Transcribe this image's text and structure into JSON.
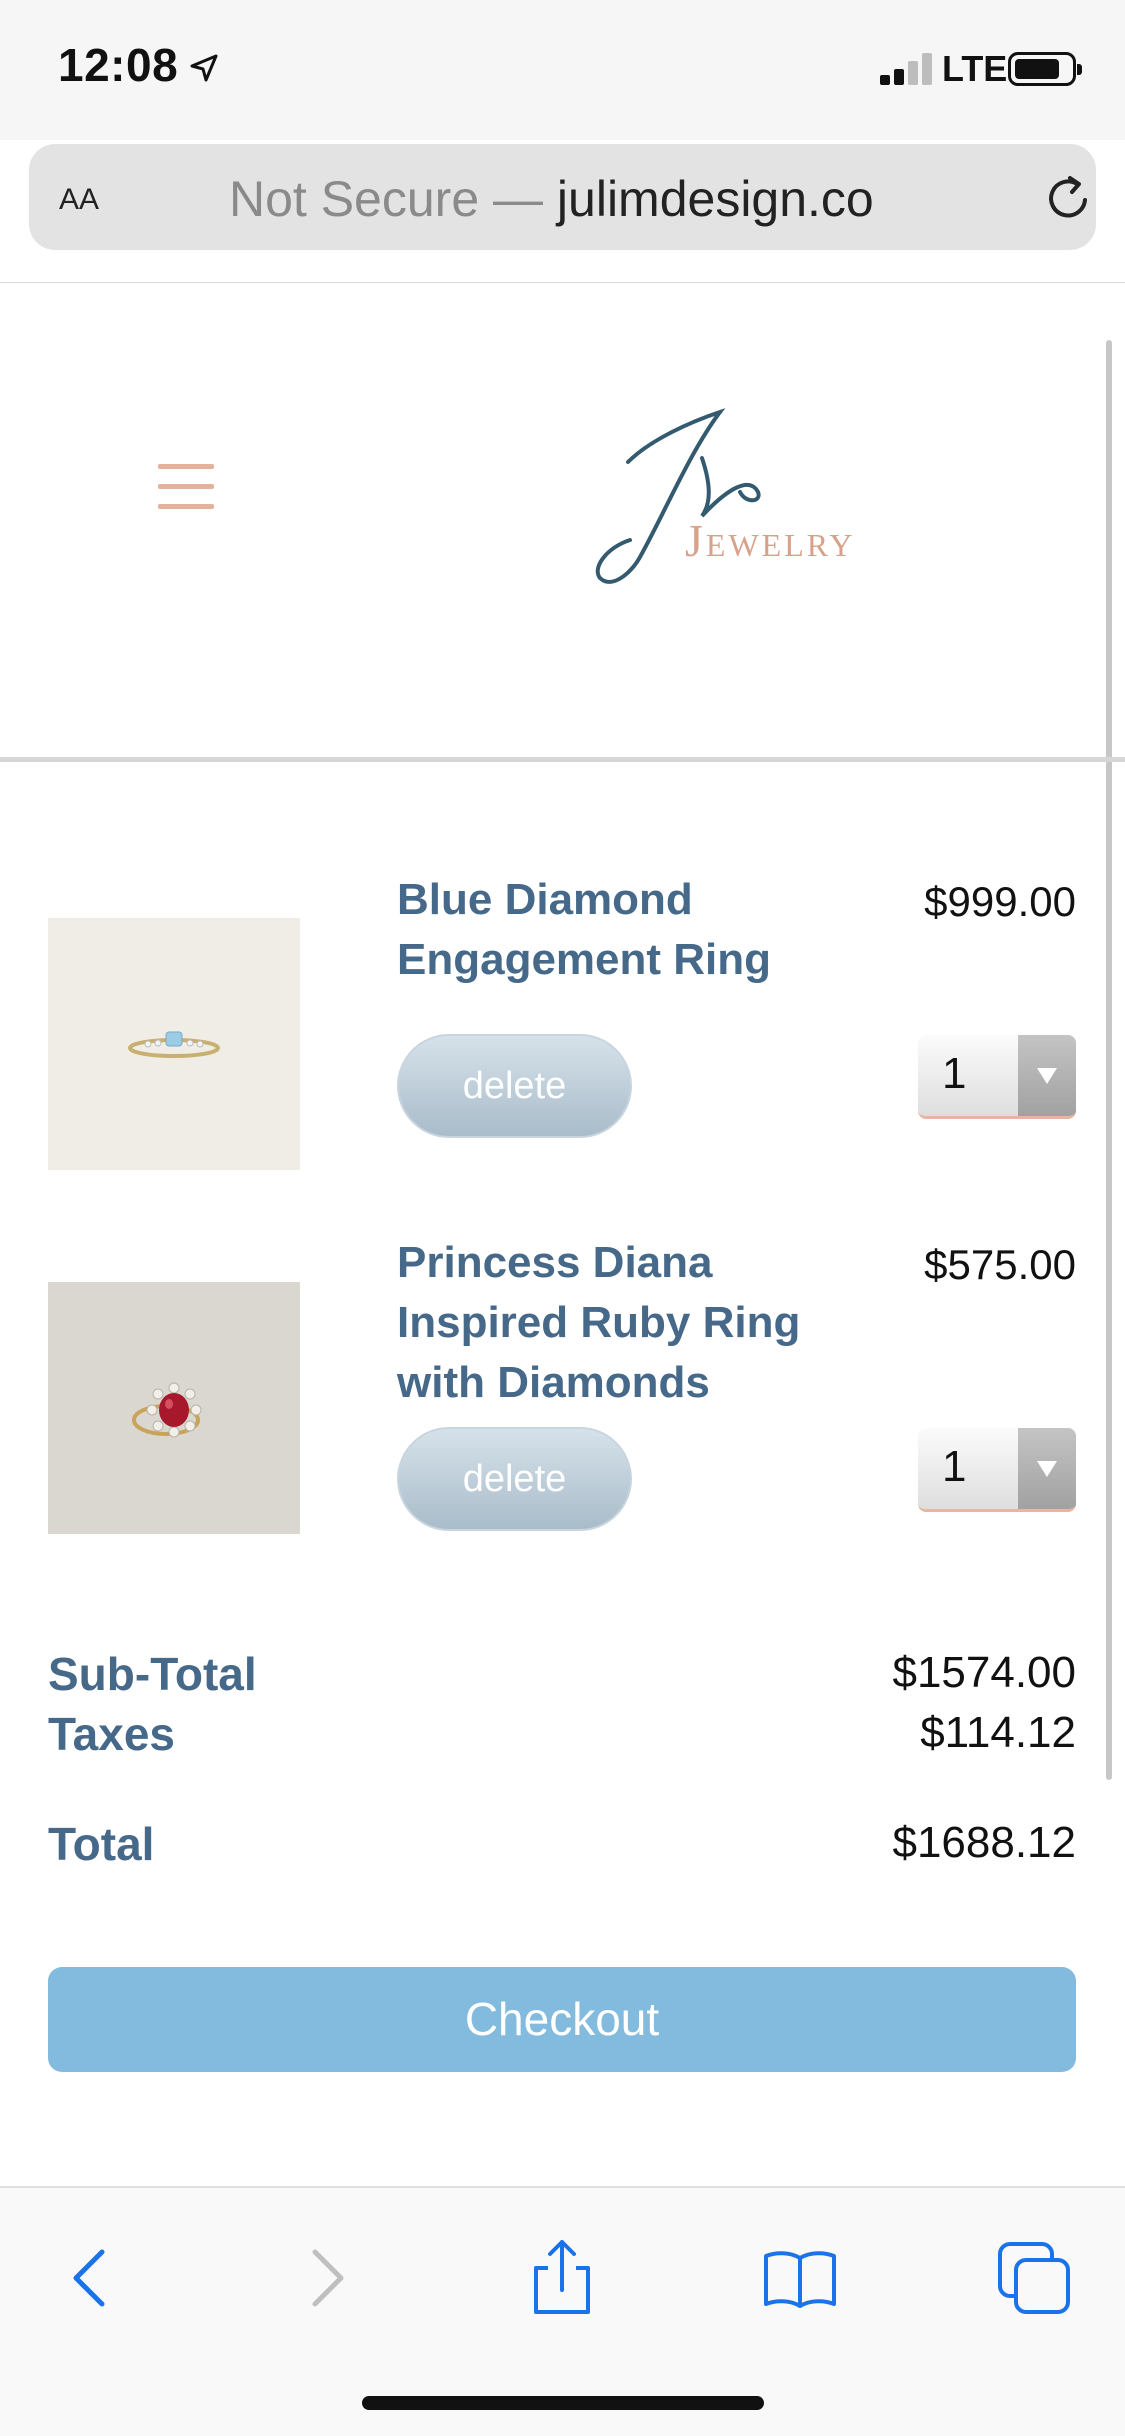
{
  "status_bar": {
    "time": "12:08",
    "network": "LTE"
  },
  "address_bar": {
    "text_size_label": "AA",
    "security_label": "Not Secure —",
    "domain": "julimdesign.co"
  },
  "brand": {
    "logo_text": "Jewelry",
    "accent_color": "#d8a18a",
    "primary_text_color": "#46698a"
  },
  "cart": {
    "items": [
      {
        "name": "Blue Diamond Engagement Ring",
        "price": "$999.00",
        "delete_label": "delete",
        "quantity": "1",
        "image_icon": "ring-blue-diamond-icon"
      },
      {
        "name": "Princess Diana Inspired Ruby Ring with Diamonds",
        "price": "$575.00",
        "delete_label": "delete",
        "quantity": "1",
        "image_icon": "ring-ruby-icon"
      }
    ],
    "subtotal_label": "Sub-Total",
    "subtotal_value": "$1574.00",
    "taxes_label": "Taxes",
    "taxes_value": "$114.12",
    "total_label": "Total",
    "total_value": "$1688.12",
    "checkout_label": "Checkout",
    "checkout_color": "#83bbde"
  },
  "toolbar": {
    "icons": [
      "back-icon",
      "forward-icon",
      "share-icon",
      "bookmarks-icon",
      "tabs-icon"
    ]
  }
}
